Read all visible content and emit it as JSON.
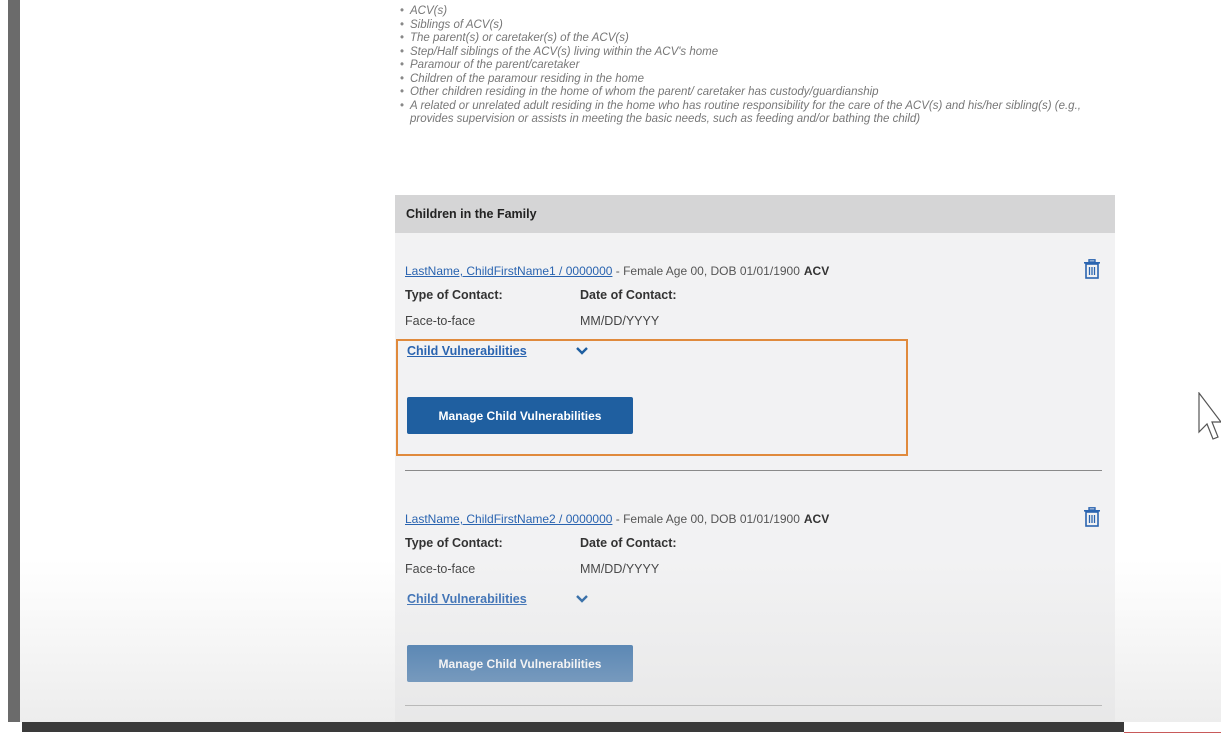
{
  "criteria": [
    "ACV(s)",
    "Siblings of ACV(s)",
    "The parent(s) or caretaker(s) of the ACV(s)",
    "Step/Half siblings of the ACV(s) living within the ACV's home",
    "Paramour of the parent/caretaker",
    "Children of the paramour residing in the home",
    "Other children residing in the home of whom the parent/ caretaker has custody/guardianship",
    "A related or unrelated adult residing in the home who has routine responsibility for the care of the ACV(s) and his/her sibling(s) (e.g., provides supervision or assists in meeting the basic needs, such as feeding and/or bathing the child)"
  ],
  "panel": {
    "title": "Children in the Family",
    "children": [
      {
        "name_link": "LastName, ChildFirstName1 / 0000000",
        "details": " - Female Age 00, DOB 01/01/1900",
        "tag": "ACV",
        "type_label": "Type of Contact:",
        "date_label": "Date of Contact:",
        "type_value": "Face-to-face",
        "date_value": "MM/DD/YYYY",
        "vuln_label": "Child Vulnerabilities",
        "manage_label": "Manage Child Vulnerabilities"
      },
      {
        "name_link": "LastName, ChildFirstName2 / 0000000",
        "details": " - Female Age 00, DOB 01/01/1900",
        "tag": "ACV",
        "type_label": "Type of Contact:",
        "date_label": "Date of Contact:",
        "type_value": "Face-to-face",
        "date_value": "MM/DD/YYYY",
        "vuln_label": "Child Vulnerabilities",
        "manage_label": "Manage Child Vulnerabilities"
      }
    ]
  },
  "icons": {
    "delete": "trash-icon",
    "expand": "chevron-down-icon",
    "pointer": "mouse-cursor-icon"
  },
  "colors": {
    "link": "#2a64b0",
    "button": "#1f5fa0",
    "highlight": "#e08a3c",
    "panel_header": "#d5d5d6",
    "panel_bg": "#f2f2f3"
  }
}
